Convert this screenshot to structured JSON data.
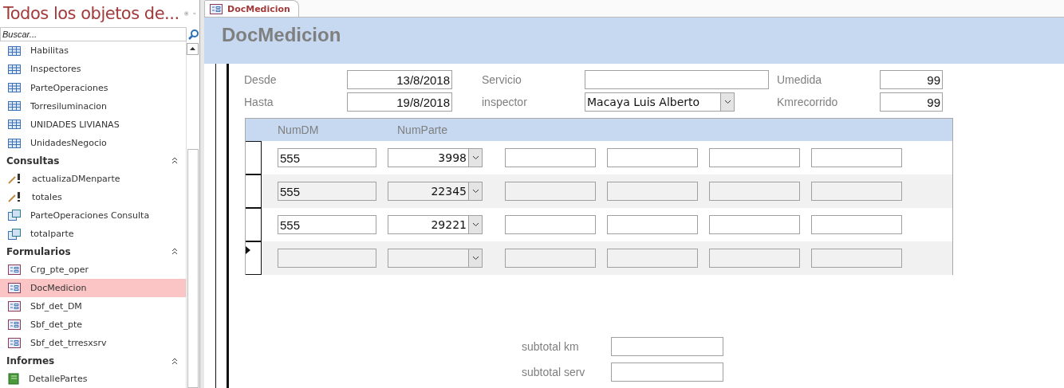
{
  "nav": {
    "title": "Todos los objetos de...",
    "search": {
      "placeholder": "Buscar..."
    },
    "groups": [
      {
        "items": [
          {
            "label": "Habilitas",
            "kind": "table",
            "selected": false
          },
          {
            "label": "Inspectores",
            "kind": "table",
            "selected": false
          },
          {
            "label": "ParteOperaciones",
            "kind": "table",
            "selected": false
          },
          {
            "label": "Torresiluminacion",
            "kind": "table",
            "selected": false
          },
          {
            "label": "UNIDADES LIVIANAS",
            "kind": "table",
            "selected": false
          },
          {
            "label": "UnidadesNegocio",
            "kind": "table",
            "selected": false
          }
        ]
      },
      {
        "name": "Consultas",
        "items": [
          {
            "label": "actualizaDMenparte",
            "kind": "action",
            "selected": false
          },
          {
            "label": "totales",
            "kind": "action",
            "selected": false
          },
          {
            "label": "ParteOperaciones Consulta",
            "kind": "query",
            "selected": false
          },
          {
            "label": "totalparte",
            "kind": "query",
            "selected": false
          }
        ]
      },
      {
        "name": "Formularios",
        "items": [
          {
            "label": "Crg_pte_oper",
            "kind": "form",
            "selected": false
          },
          {
            "label": "DocMedicion",
            "kind": "form",
            "selected": true
          },
          {
            "label": "Sbf_det_DM",
            "kind": "form",
            "selected": false
          },
          {
            "label": "Sbf_det_pte",
            "kind": "form",
            "selected": false
          },
          {
            "label": "Sbf_det_trresxsrv",
            "kind": "form",
            "selected": false
          }
        ]
      },
      {
        "name": "Informes",
        "items": [
          {
            "label": "DetallePartes",
            "kind": "report",
            "selected": false
          }
        ]
      }
    ]
  },
  "tab": {
    "label": "DocMedicion",
    "selected": true
  },
  "form": {
    "title": "DocMedicion",
    "fields": [
      [
        {
          "label": "Desde",
          "value": "13/8/2018",
          "kind": "text"
        },
        {
          "label": "Servicio",
          "kind": "text"
        },
        {
          "label": "Umedida",
          "value": "99",
          "kind": "text"
        }
      ],
      [
        {
          "label": "Hasta",
          "value": "19/8/2018",
          "kind": "text"
        },
        {
          "label": "inspector",
          "value": "Macaya Luis Alberto",
          "kind": "combo"
        },
        {
          "label": "Kmrecorrido",
          "value": "99",
          "kind": "text"
        }
      ]
    ],
    "subform": {
      "columns": [
        "NumDM",
        "NumParte"
      ],
      "rows": [
        {
          "numdm": "555",
          "numparte": "3998",
          "current": false
        },
        {
          "numdm": "555",
          "numparte": "22345",
          "current": false
        },
        {
          "numdm": "555",
          "numparte": "29221",
          "current": false
        },
        {
          "numdm": "",
          "numparte": "",
          "current": true
        }
      ]
    },
    "totals": [
      {
        "label": "subtotal km"
      },
      {
        "label": "subtotal serv"
      }
    ]
  }
}
